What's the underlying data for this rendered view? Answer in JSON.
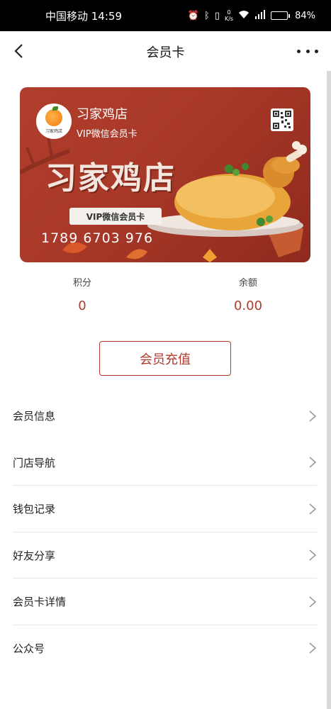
{
  "status_bar": {
    "carrier_time": "中国移动 14:59",
    "net_speed_value": "0",
    "net_speed_unit": "K/s",
    "battery": "84%",
    "battery_level": 0.84
  },
  "nav": {
    "title": "会员卡"
  },
  "card": {
    "store_name": "习家鸡店",
    "card_type": "VIP微信会员卡",
    "logo_text": "习家鸡店",
    "big_name": "习家鸡店",
    "badge": "VIP微信会员卡",
    "card_number": "1789 6703 976"
  },
  "stats": {
    "points_label": "积分",
    "points_value": "0",
    "balance_label": "余额",
    "balance_value": "0.00"
  },
  "recharge_label": "会员充值",
  "menu": {
    "items": [
      {
        "label": "会员信息"
      },
      {
        "label": "门店导航"
      },
      {
        "label": "钱包记录"
      },
      {
        "label": "好友分享"
      },
      {
        "label": "会员卡详情"
      },
      {
        "label": "公众号"
      }
    ]
  },
  "colors": {
    "accent": "#b03a2e",
    "card_bg": "#a83828"
  }
}
